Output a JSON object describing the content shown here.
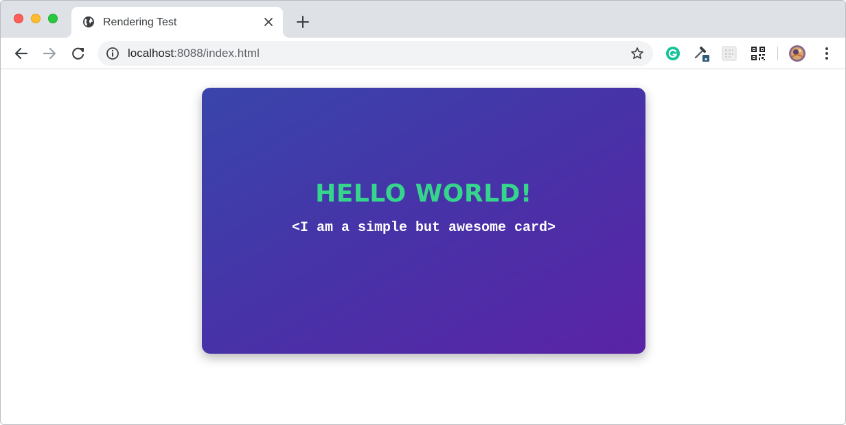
{
  "browser": {
    "tab": {
      "title": "Rendering Test"
    },
    "address_bar": {
      "host": "localhost",
      "rest": ":8088/index.html"
    }
  },
  "page": {
    "card": {
      "title": "HELLO WORLD!",
      "subtitle": "<I am a simple but awesome card>",
      "title_color": "#35d68c",
      "gradient_start": "#3945ab",
      "gradient_end": "#5a23a6"
    }
  },
  "icons": {
    "tab_favicon": "globe-icon",
    "tab_close": "close-icon",
    "new_tab": "plus-icon",
    "back": "arrow-left-icon",
    "forward": "arrow-right-icon",
    "reload": "reload-icon",
    "site_info": "info-icon",
    "bookmark": "star-icon",
    "extensions": [
      "grammarly-icon",
      "eyedropper-icon",
      "grid-extension-icon",
      "qr-code-icon"
    ],
    "profile": "avatar",
    "menu": "more-vert-icon"
  }
}
